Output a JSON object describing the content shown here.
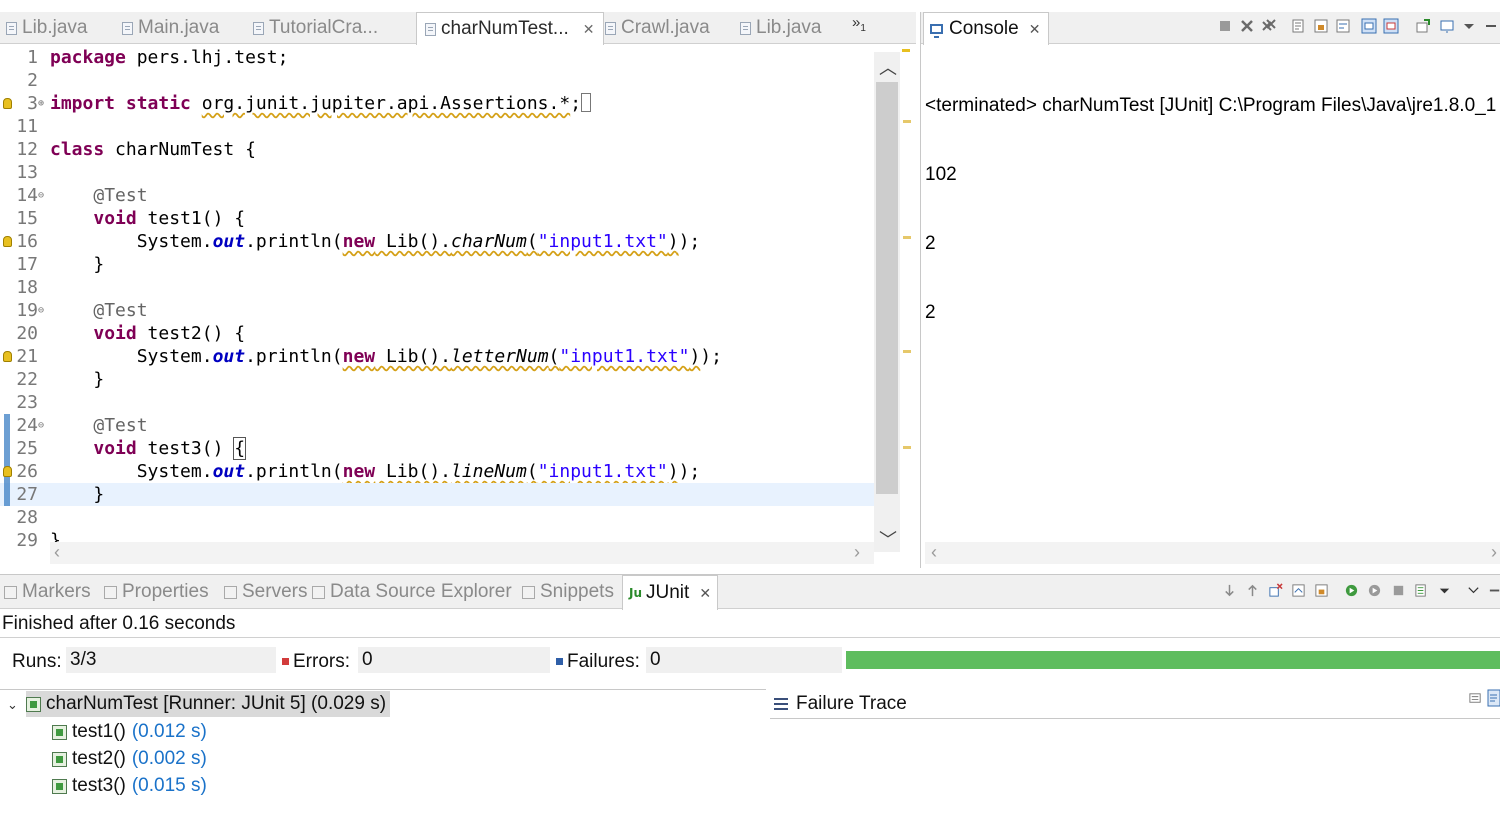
{
  "editor": {
    "tabs": [
      {
        "label": "Lib.java",
        "active": false
      },
      {
        "label": "Main.java",
        "active": false
      },
      {
        "label": "TutorialCra...",
        "active": false
      },
      {
        "label": "charNumTest...",
        "active": true
      },
      {
        "label": "Crawl.java",
        "active": false
      },
      {
        "label": "Lib.java",
        "active": false
      }
    ],
    "overflow_count": "1",
    "lines": [
      {
        "num": "1",
        "parts": [
          {
            "t": "package",
            "c": "kw"
          },
          {
            "t": " pers.lhj.test;",
            "c": ""
          }
        ]
      },
      {
        "num": "2",
        "parts": []
      },
      {
        "num": "3",
        "fold": "plus",
        "marker": "bulb",
        "parts": [
          {
            "t": "import static",
            "c": "kw"
          },
          {
            "t": " ",
            "c": ""
          },
          {
            "t": "org.junit.jupiter.api.Assertions.*",
            "c": "warn"
          },
          {
            "t": ";",
            "c": ""
          }
        ],
        "collapsed_box": true
      },
      {
        "num": "11",
        "parts": []
      },
      {
        "num": "12",
        "parts": [
          {
            "t": "class",
            "c": "kw"
          },
          {
            "t": " charNumTest {",
            "c": ""
          }
        ]
      },
      {
        "num": "13",
        "parts": []
      },
      {
        "num": "14",
        "fold": "minus",
        "parts": [
          {
            "t": "    ",
            "c": ""
          },
          {
            "t": "@Test",
            "c": "ann"
          }
        ]
      },
      {
        "num": "15",
        "parts": [
          {
            "t": "    ",
            "c": ""
          },
          {
            "t": "void",
            "c": "kw"
          },
          {
            "t": " test1() {",
            "c": ""
          }
        ]
      },
      {
        "num": "16",
        "marker": "bulb",
        "parts": [
          {
            "t": "        System.",
            "c": ""
          },
          {
            "t": "out",
            "c": "fld"
          },
          {
            "t": ".println(",
            "c": ""
          },
          {
            "t": "new",
            "c": "kw warn"
          },
          {
            "t": " Lib().",
            "c": "warn"
          },
          {
            "t": "charNum",
            "c": "ital warn"
          },
          {
            "t": "(",
            "c": "warn"
          },
          {
            "t": "\"input1.txt\"",
            "c": "str warn"
          },
          {
            "t": ")",
            "c": "warn"
          },
          {
            "t": ");",
            "c": ""
          }
        ]
      },
      {
        "num": "17",
        "parts": [
          {
            "t": "    }",
            "c": ""
          }
        ]
      },
      {
        "num": "18",
        "parts": []
      },
      {
        "num": "19",
        "fold": "minus",
        "parts": [
          {
            "t": "    ",
            "c": ""
          },
          {
            "t": "@Test",
            "c": "ann"
          }
        ]
      },
      {
        "num": "20",
        "parts": [
          {
            "t": "    ",
            "c": ""
          },
          {
            "t": "void",
            "c": "kw"
          },
          {
            "t": " test2() {",
            "c": ""
          }
        ]
      },
      {
        "num": "21",
        "marker": "bulb",
        "parts": [
          {
            "t": "        System.",
            "c": ""
          },
          {
            "t": "out",
            "c": "fld"
          },
          {
            "t": ".println(",
            "c": ""
          },
          {
            "t": "new",
            "c": "kw warn"
          },
          {
            "t": " Lib().",
            "c": "warn"
          },
          {
            "t": "letterNum",
            "c": "ital warn"
          },
          {
            "t": "(",
            "c": "warn"
          },
          {
            "t": "\"input1.txt\"",
            "c": "str warn"
          },
          {
            "t": ")",
            "c": "warn"
          },
          {
            "t": ");",
            "c": ""
          }
        ]
      },
      {
        "num": "22",
        "parts": [
          {
            "t": "    }",
            "c": ""
          }
        ]
      },
      {
        "num": "23",
        "parts": []
      },
      {
        "num": "24",
        "fold": "minus",
        "marker": "bar",
        "parts": [
          {
            "t": "    ",
            "c": ""
          },
          {
            "t": "@Test",
            "c": "ann"
          }
        ]
      },
      {
        "num": "25",
        "marker": "bar",
        "parts": [
          {
            "t": "    ",
            "c": ""
          },
          {
            "t": "void",
            "c": "kw"
          },
          {
            "t": " test3() ",
            "c": ""
          },
          {
            "t": "{",
            "c": "boxed"
          }
        ]
      },
      {
        "num": "26",
        "marker": "barbulb",
        "parts": [
          {
            "t": "        System.",
            "c": ""
          },
          {
            "t": "out",
            "c": "fld"
          },
          {
            "t": ".println(",
            "c": ""
          },
          {
            "t": "new",
            "c": "kw warn"
          },
          {
            "t": " Lib().",
            "c": "warn"
          },
          {
            "t": "lineNum",
            "c": "ital warn"
          },
          {
            "t": "(",
            "c": "warn"
          },
          {
            "t": "\"input1.txt\"",
            "c": "str warn"
          },
          {
            "t": ")",
            "c": "warn"
          },
          {
            "t": ");",
            "c": ""
          }
        ]
      },
      {
        "num": "27",
        "marker": "bar",
        "current": true,
        "parts": [
          {
            "t": "    }",
            "c": ""
          }
        ]
      },
      {
        "num": "28",
        "parts": []
      },
      {
        "num": "29",
        "parts": [
          {
            "t": "}",
            "c": ""
          }
        ]
      }
    ]
  },
  "console": {
    "tab_label": "Console",
    "header": "<terminated> charNumTest [JUnit] C:\\Program Files\\Java\\jre1.8.0_1",
    "output": [
      "102",
      "2",
      "2"
    ]
  },
  "bottom_tabs": [
    {
      "label": "Markers",
      "icon": "markers-icon"
    },
    {
      "label": "Properties",
      "icon": "properties-icon"
    },
    {
      "label": "Servers",
      "icon": "servers-icon"
    },
    {
      "label": "Data Source Explorer",
      "icon": "data-source-icon"
    },
    {
      "label": "Snippets",
      "icon": "snippets-icon"
    },
    {
      "label": "JUnit",
      "icon": "junit-icon",
      "active": true
    }
  ],
  "junit": {
    "finished": "Finished after 0.16 seconds",
    "runs_label": "Runs:",
    "runs_value": "3/3",
    "errors_label": "Errors:",
    "errors_value": "0",
    "failures_label": "Failures:",
    "failures_value": "0",
    "progress_fraction": 1.0,
    "progress_color": "#5ebd5e",
    "root": {
      "label": "charNumTest [Runner: JUnit 5] (0.029 s)"
    },
    "tests": [
      {
        "name": "test1()",
        "time": "(0.012 s)"
      },
      {
        "name": "test2()",
        "time": "(0.002 s)"
      },
      {
        "name": "test3()",
        "time": "(0.015 s)"
      }
    ],
    "failure_trace_label": "Failure Trace"
  },
  "colors": {
    "keyword": "#7f0055",
    "string": "#2a00ff",
    "field": "#0000c0",
    "annotation": "#646464",
    "time": "#1a72c9"
  }
}
